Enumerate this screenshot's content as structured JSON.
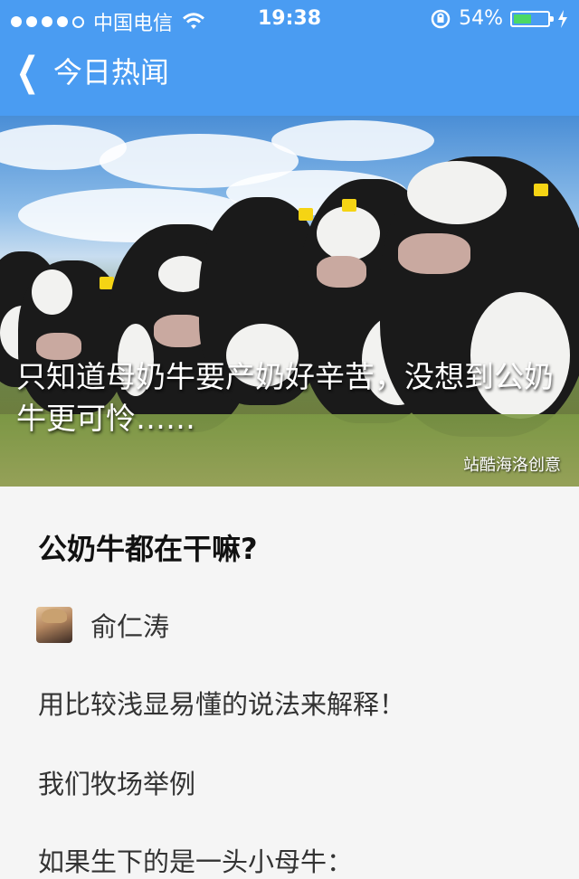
{
  "status_bar": {
    "carrier": "中国电信",
    "time": "19:38",
    "battery_percent": "54%",
    "battery_level": 0.54,
    "signal_bars_filled": 4,
    "signal_bars_total": 5,
    "icons": [
      "signal-dots-icon",
      "wifi-icon",
      "rotation-lock-icon",
      "battery-icon",
      "charging-bolt-icon"
    ]
  },
  "nav": {
    "back_icon": "chevron-left-icon",
    "title": "今日热闻"
  },
  "hero": {
    "title": "只知道母奶牛要产奶好辛苦，没想到公奶牛更可怜……",
    "credit": "站酷海洛创意"
  },
  "article": {
    "question": "公奶牛都在干嘛?",
    "author": {
      "name": "俞仁涛",
      "avatar": "avatar-photo"
    },
    "paragraphs": [
      "用比较浅显易懂的说法来解释！",
      "我们牧场举例",
      "如果生下的是一头小母牛："
    ]
  },
  "colors": {
    "nav_bg": "#4a9cf2",
    "battery_fill": "#4cd964"
  }
}
